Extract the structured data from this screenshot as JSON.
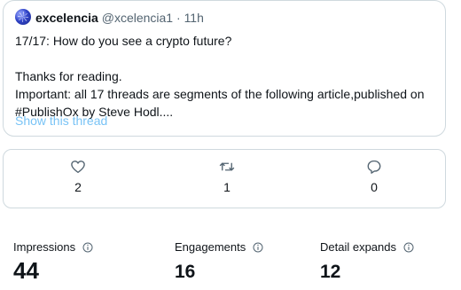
{
  "tweet": {
    "display_name": "excelencia",
    "handle": "@xcelencia1",
    "separator": "·",
    "time": "11h",
    "lines": [
      "17/17: How do you see a crypto future?",
      "Thanks for reading.",
      "Important: all 17 threads are segments of the following article,published on",
      "#PublishOx by  Steve Hodl...."
    ],
    "show_thread": "Show this thread"
  },
  "actions": {
    "likes": "2",
    "retweets": "1",
    "replies": "0"
  },
  "metrics": {
    "impressions": {
      "label": "Impressions",
      "value": "44"
    },
    "engagements": {
      "label": "Engagements",
      "value": "16"
    },
    "detail_expands": {
      "label": "Detail expands",
      "value": "12"
    }
  },
  "colors": {
    "link": "#1d9bf0",
    "secondary_text": "#536471",
    "border": "#cfd9de"
  },
  "icons": [
    "heart-icon",
    "retweet-icon",
    "reply-icon",
    "info-icon"
  ]
}
